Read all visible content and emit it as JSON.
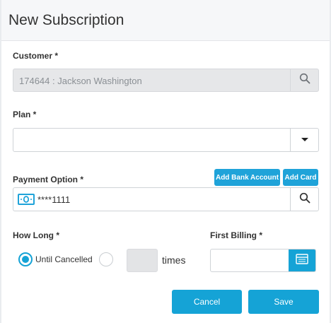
{
  "modal": {
    "title": "New Subscription"
  },
  "customer": {
    "label": "Customer *",
    "value": "174644 : Jackson Washington",
    "search_icon": "search-icon"
  },
  "plan": {
    "label": "Plan *",
    "value": "",
    "dropdown_icon": "caret-down-icon"
  },
  "payment": {
    "label": "Payment Option *",
    "add_bank_label": "Add Bank Account",
    "add_card_label": "Add Card",
    "value": "****1111",
    "method_icon": "cash-icon",
    "search_icon": "search-icon"
  },
  "how_long": {
    "label": "How Long *",
    "option_until_cancelled": "Until Cancelled",
    "selected": "until_cancelled",
    "times_value": "",
    "times_label": "times"
  },
  "first_billing": {
    "label": "First Billing *",
    "value": "",
    "calendar_icon": "calendar-icon"
  },
  "footer": {
    "cancel_label": "Cancel",
    "save_label": "Save"
  },
  "colors": {
    "accent": "#15a3d6",
    "header_bg": "#f6f7f9",
    "disabled_bg": "#e6e7e9"
  }
}
